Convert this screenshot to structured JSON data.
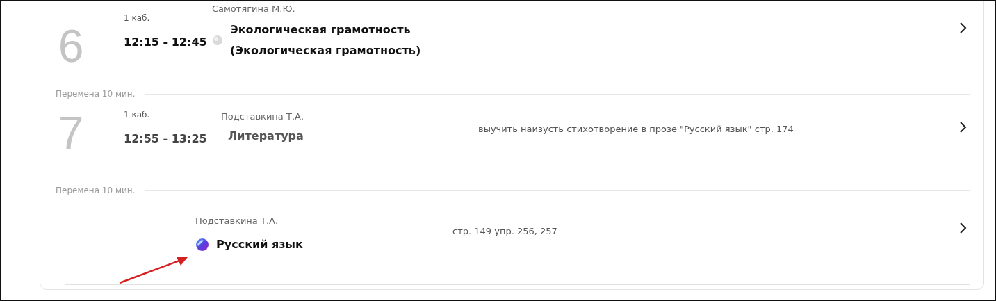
{
  "lessons": [
    {
      "number": "6",
      "room": "1 каб.",
      "time": "12:15 - 12:45",
      "teacher": "Самотягина М.Ю.",
      "subject": "Экологическая грамотность (Экологическая грамотность)",
      "kind": "plain",
      "muted": false
    },
    {
      "number": "7",
      "room": "1 каб.",
      "time": "12:55 - 13:25",
      "teacher": "Подставкина Т.А.",
      "subject": "Литература",
      "homework": "выучить наизусть стихотворение в прозе \"Русский язык\" стр. 174",
      "muted": true
    },
    {
      "teacher": "Подставкина Т.А.",
      "subject": "Русский язык",
      "kind": "colored",
      "homework": "стр. 149 упр. 256, 257",
      "muted": false
    }
  ],
  "breaks": [
    "Перемена 10 мин.",
    "Перемена 10 мин."
  ]
}
